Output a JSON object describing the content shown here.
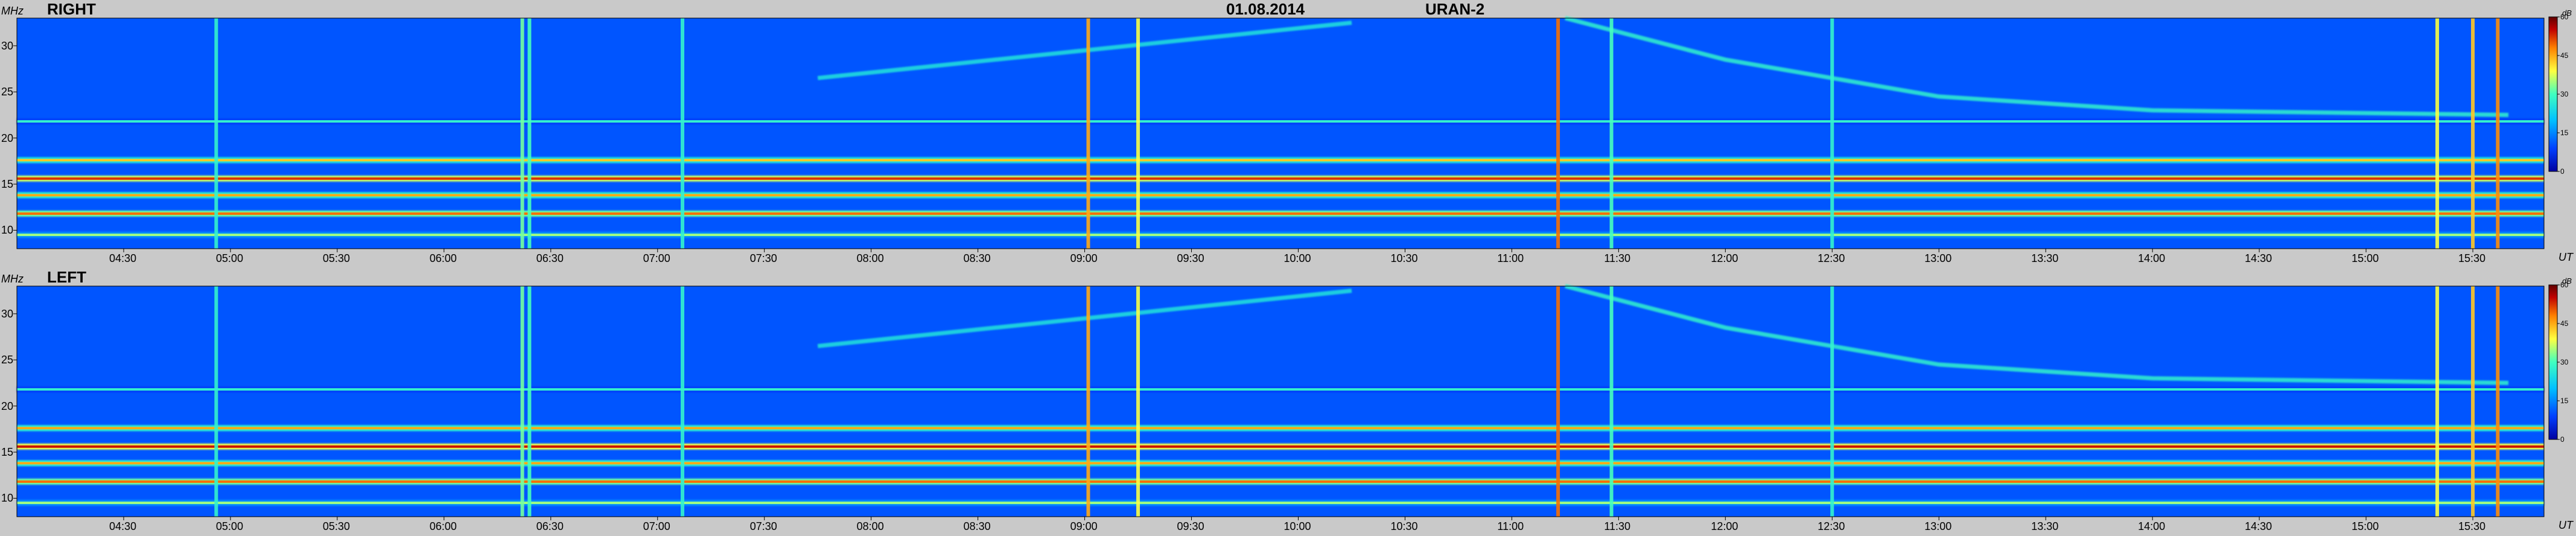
{
  "header": {
    "date": "01.08.2014",
    "instrument": "URAN-2"
  },
  "units": {
    "frequency": "MHz",
    "time": "UT",
    "scale": "dB"
  },
  "chart_data": [
    {
      "type": "heatmap",
      "title": "RIGHT",
      "xlabel": "UT",
      "ylabel": "MHz",
      "x_range": [
        "04:00",
        "15:50"
      ],
      "ylim": [
        8,
        33
      ],
      "x_tick_labels": [
        "04:30",
        "05:00",
        "05:30",
        "06:00",
        "06:30",
        "07:00",
        "07:30",
        "08:00",
        "08:30",
        "09:00",
        "09:30",
        "10:00",
        "10:30",
        "11:00",
        "11:30",
        "12:00",
        "12:30",
        "13:00",
        "13:30",
        "14:00",
        "14:30",
        "15:00",
        "15:30"
      ],
      "y_tick_labels": [
        "10",
        "15",
        "20",
        "25",
        "30"
      ],
      "colorbar": {
        "label": "dB",
        "range": [
          0,
          60
        ],
        "ticks": [
          "0",
          "15",
          "30",
          "45",
          "60"
        ]
      },
      "colormap": [
        "#0000a0",
        "#0040ff",
        "#00c0ff",
        "#40ffc0",
        "#ffff40",
        "#ff8000",
        "#c00000",
        "#600000"
      ],
      "background_level_db": 10,
      "interference_bands_mhz": [
        {
          "freq": 9.5,
          "level_db": 30
        },
        {
          "freq": 11.8,
          "level_db": 44
        },
        {
          "freq": 13.8,
          "level_db": 40
        },
        {
          "freq": 15.6,
          "level_db": 48
        },
        {
          "freq": 17.6,
          "level_db": 38
        },
        {
          "freq": 21.8,
          "level_db": 24
        }
      ],
      "broadband_bursts_ut": [
        {
          "time": "04:56",
          "level_db": 24
        },
        {
          "time": "06:22",
          "level_db": 28
        },
        {
          "time": "06:24",
          "level_db": 26
        },
        {
          "time": "07:07",
          "level_db": 24
        },
        {
          "time": "09:01",
          "level_db": 40
        },
        {
          "time": "09:15",
          "level_db": 34
        },
        {
          "time": "11:13",
          "level_db": 44
        },
        {
          "time": "11:28",
          "level_db": 26
        },
        {
          "time": "12:30",
          "level_db": 24
        },
        {
          "time": "15:20",
          "level_db": 34
        },
        {
          "time": "15:30",
          "level_db": 38
        },
        {
          "time": "15:37",
          "level_db": 42
        }
      ],
      "drifting_features": [
        {
          "points": [
            [
              "07:45",
              26.5
            ],
            [
              "09:00",
              29.5
            ],
            [
              "10:15",
              32.5
            ]
          ],
          "level_db": 22
        },
        {
          "points": [
            [
              "11:15",
              33
            ],
            [
              "12:00",
              28.5
            ],
            [
              "13:00",
              24.5
            ],
            [
              "14:00",
              23
            ],
            [
              "15:40",
              22.5
            ]
          ],
          "level_db": 24
        }
      ]
    },
    {
      "type": "heatmap",
      "title": "LEFT",
      "xlabel": "UT",
      "ylabel": "MHz",
      "x_range": [
        "04:00",
        "15:50"
      ],
      "ylim": [
        8,
        33
      ],
      "x_tick_labels": [
        "04:30",
        "05:00",
        "05:30",
        "06:00",
        "06:30",
        "07:00",
        "07:30",
        "08:00",
        "08:30",
        "09:00",
        "09:30",
        "10:00",
        "10:30",
        "11:00",
        "11:30",
        "12:00",
        "12:30",
        "13:00",
        "13:30",
        "14:00",
        "14:30",
        "15:00",
        "15:30"
      ],
      "y_tick_labels": [
        "10",
        "15",
        "20",
        "25",
        "30"
      ],
      "colorbar": {
        "label": "dB",
        "range": [
          0,
          60
        ],
        "ticks": [
          "0",
          "15",
          "30",
          "45",
          "60"
        ]
      },
      "colormap": [
        "#0000a0",
        "#0040ff",
        "#00c0ff",
        "#40ffc0",
        "#ffff40",
        "#ff8000",
        "#c00000",
        "#600000"
      ],
      "background_level_db": 10,
      "interference_bands_mhz": [
        {
          "freq": 9.5,
          "level_db": 30
        },
        {
          "freq": 11.8,
          "level_db": 44
        },
        {
          "freq": 13.8,
          "level_db": 40
        },
        {
          "freq": 15.6,
          "level_db": 50
        },
        {
          "freq": 17.6,
          "level_db": 40
        },
        {
          "freq": 21.8,
          "level_db": 24
        }
      ],
      "broadband_bursts_ut": [
        {
          "time": "04:56",
          "level_db": 24
        },
        {
          "time": "06:22",
          "level_db": 28
        },
        {
          "time": "06:24",
          "level_db": 26
        },
        {
          "time": "07:07",
          "level_db": 24
        },
        {
          "time": "09:01",
          "level_db": 40
        },
        {
          "time": "09:15",
          "level_db": 34
        },
        {
          "time": "11:13",
          "level_db": 44
        },
        {
          "time": "11:28",
          "level_db": 26
        },
        {
          "time": "12:30",
          "level_db": 24
        },
        {
          "time": "15:20",
          "level_db": 34
        },
        {
          "time": "15:30",
          "level_db": 38
        },
        {
          "time": "15:37",
          "level_db": 42
        }
      ],
      "drifting_features": [
        {
          "points": [
            [
              "07:45",
              26.5
            ],
            [
              "09:00",
              29.5
            ],
            [
              "10:15",
              32.5
            ]
          ],
          "level_db": 22
        },
        {
          "points": [
            [
              "11:15",
              33
            ],
            [
              "12:00",
              28.5
            ],
            [
              "13:00",
              24.5
            ],
            [
              "14:00",
              23
            ],
            [
              "15:40",
              22.5
            ]
          ],
          "level_db": 24
        }
      ]
    }
  ]
}
